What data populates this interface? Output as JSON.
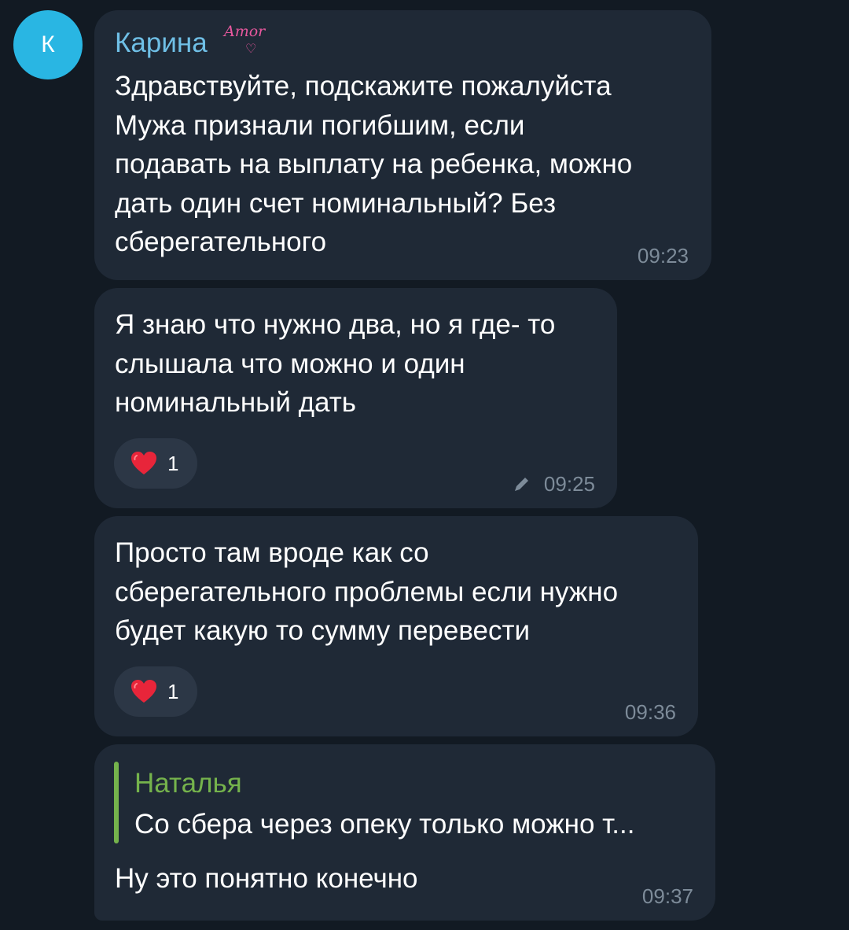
{
  "avatar": {
    "initial": "К",
    "color": "#29b6e3"
  },
  "messages": [
    {
      "sender": "Карина",
      "sender_badge": "Amor",
      "lines": [
        "Здравствуйте, подскажите пожалуйста",
        "Мужа признали погибшим, если",
        "подавать на выплату на ребенка, можно",
        "дать один счет номинальный? Без",
        "сберегательного"
      ],
      "time": "09:23"
    },
    {
      "lines": [
        "Я знаю что нужно два, но я где- то",
        "слышала что можно и один",
        "номинальный дать"
      ],
      "reaction": {
        "icon": "heart-icon",
        "count": "1"
      },
      "edited": true,
      "time": "09:25"
    },
    {
      "lines": [
        "Просто там вроде как со",
        "сберегательного проблемы если нужно",
        "будет какую то сумму перевести"
      ],
      "reaction": {
        "icon": "heart-icon",
        "count": "1"
      },
      "time": "09:36"
    },
    {
      "reply": {
        "name": "Наталья",
        "text": "Со сбера через опеку только можно т..."
      },
      "lines": [
        "Ну это понятно конечно"
      ],
      "time": "09:37"
    }
  ],
  "colors": {
    "background": "#121a23",
    "bubble": "#1f2936",
    "sender_name": "#6fbfe6",
    "reply_accent": "#75b34c",
    "time": "#7d8b99",
    "heart": "#e8253a"
  }
}
